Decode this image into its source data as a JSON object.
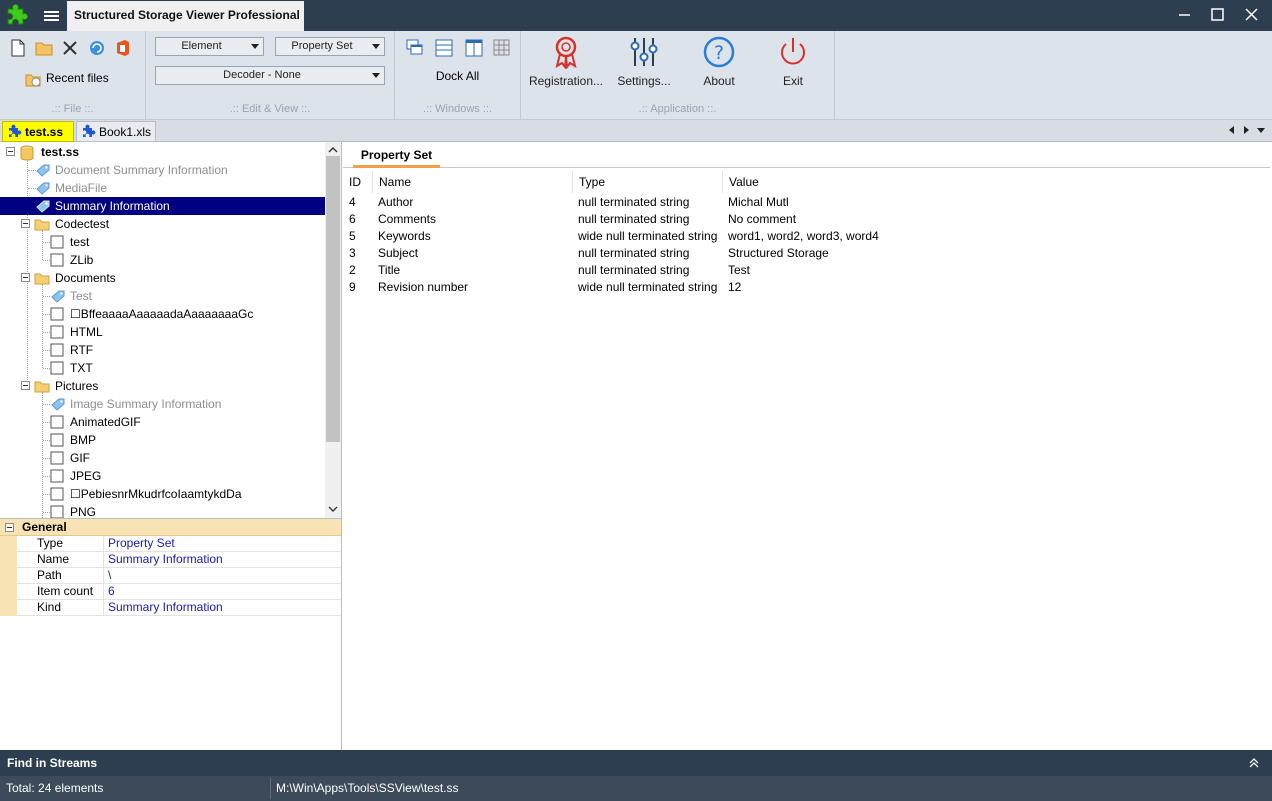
{
  "window": {
    "title": "Structured Storage Viewer Professional",
    "accent_color": "#2d3e50"
  },
  "ribbon": {
    "file_group": {
      "recent_files_label": "Recent files",
      "label": ".:: File ::."
    },
    "edit_view_group": {
      "element_dropdown": "Element",
      "property_set_dropdown": "Property Set",
      "decoder_dropdown": "Decoder - None",
      "label": ".:: Edit & View ::."
    },
    "windows_group": {
      "dock_all_label": "Dock All",
      "label": ".:: Windows ::."
    },
    "application_group": {
      "registration_label": "Registration...",
      "settings_label": "Settings...",
      "about_label": "About",
      "exit_label": "Exit",
      "label": ".:: Application ::."
    }
  },
  "doc_tabs": [
    {
      "label": "test.ss",
      "active": true
    },
    {
      "label": "Book1.xls",
      "active": false
    }
  ],
  "tree": {
    "root": "test.ss",
    "nodes": [
      {
        "label": "Document Summary Information"
      },
      {
        "label": "MediaFile"
      },
      {
        "label": "Summary Information"
      },
      {
        "label": "Codectest"
      },
      {
        "label": "test"
      },
      {
        "label": "ZLib"
      },
      {
        "label": "Documents"
      },
      {
        "label": "Test"
      },
      {
        "label": "☐BffeaaaaAaaaaadaAaaaaaaaGc"
      },
      {
        "label": "HTML"
      },
      {
        "label": "RTF"
      },
      {
        "label": "TXT"
      },
      {
        "label": "Pictures"
      },
      {
        "label": "Image Summary Information"
      },
      {
        "label": "AnimatedGIF"
      },
      {
        "label": "BMP"
      },
      {
        "label": "GIF"
      },
      {
        "label": "JPEG"
      },
      {
        "label": "☐PebiesnrMkudrfcoIaamtykdDa"
      },
      {
        "label": "PNG"
      }
    ]
  },
  "properties": {
    "category": "General",
    "rows": [
      {
        "key": "Type",
        "value": "Property Set"
      },
      {
        "key": "Name",
        "value": "Summary Information"
      },
      {
        "key": "Path",
        "value": "\\"
      },
      {
        "key": "Item count",
        "value": "6"
      },
      {
        "key": "Kind",
        "value": "Summary Information"
      }
    ]
  },
  "content": {
    "tab_label": "Property Set",
    "columns": [
      "ID",
      "Name",
      "Type",
      "Value"
    ],
    "rows": [
      {
        "id": "4",
        "name": "Author",
        "type": "null terminated string",
        "value": "Michal Mutl"
      },
      {
        "id": "6",
        "name": "Comments",
        "type": "null terminated string",
        "value": "No comment"
      },
      {
        "id": "5",
        "name": "Keywords",
        "type": "wide null terminated string",
        "value": "word1, word2, word3, word4"
      },
      {
        "id": "3",
        "name": "Subject",
        "type": "null terminated string",
        "value": "Structured Storage"
      },
      {
        "id": "2",
        "name": "Title",
        "type": "null terminated string",
        "value": "Test"
      },
      {
        "id": "9",
        "name": "Revision number",
        "type": "wide null terminated string",
        "value": "12"
      }
    ]
  },
  "find_bar": {
    "label": "Find in Streams"
  },
  "status": {
    "left": "Total: 24 elements",
    "right": "M:\\Win\\Apps\\Tools\\SSView\\test.ss"
  }
}
